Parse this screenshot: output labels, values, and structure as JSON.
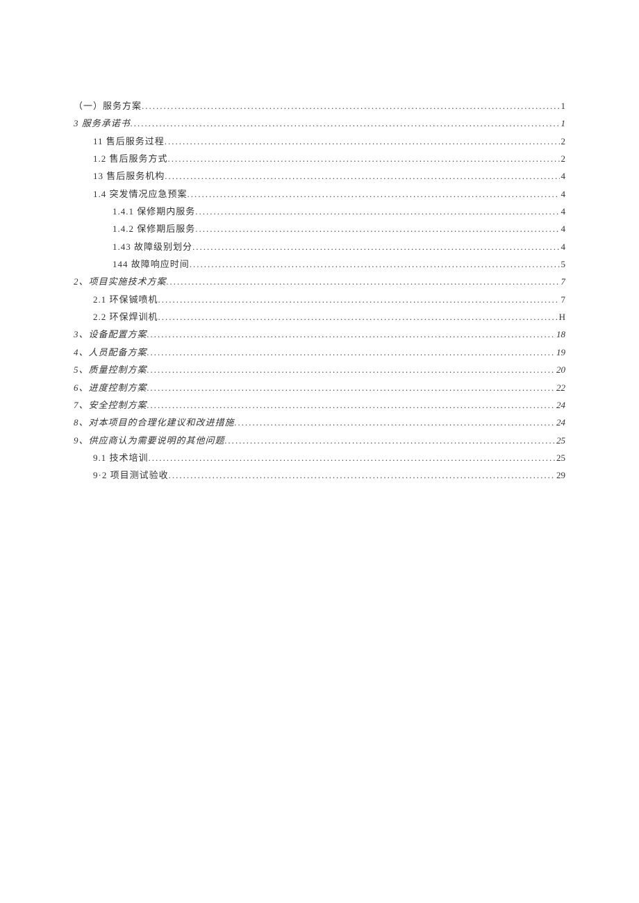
{
  "toc": [
    {
      "label": "（一）服务方案",
      "page": "1",
      "indent": 0,
      "italic": false
    },
    {
      "label": "3 服务承诺书 ",
      "page": "1",
      "indent": 0,
      "italic": true
    },
    {
      "label": "11 售后服务过程 ",
      "page": "2",
      "indent": 1,
      "italic": false
    },
    {
      "label": "1.2 售后服务方式",
      "page": "2",
      "indent": 1,
      "italic": false
    },
    {
      "label": "13 售后服务机构 ",
      "page": "4",
      "indent": 1,
      "italic": false
    },
    {
      "label": "1.4 突发情况应急预案",
      "page": "4",
      "indent": 1,
      "italic": false
    },
    {
      "label": "1.4.1 保修期内服务 ",
      "page": "4",
      "indent": 2,
      "italic": false
    },
    {
      "label": "1.4.2 保修期后服务 ",
      "page": "4",
      "indent": 2,
      "italic": false
    },
    {
      "label": "1.43 故障级别划分 ",
      "page": "4",
      "indent": 2,
      "italic": false
    },
    {
      "label": "144 故障响应时间 ",
      "page": "5",
      "indent": 2,
      "italic": false
    },
    {
      "label": "2、项目实施技术方案 ",
      "page": "7",
      "indent": 0,
      "italic": true
    },
    {
      "label": "2.1  环保铖喷机",
      "page": "7",
      "indent": 1,
      "italic": false
    },
    {
      "label": "2.2  环保焊训机",
      "page": "H",
      "indent": 1,
      "italic": false
    },
    {
      "label": "3、设备配置方案 ",
      "page": "18",
      "indent": 0,
      "italic": true
    },
    {
      "label": "4、人员配备方案",
      "page": "19",
      "indent": 0,
      "italic": true
    },
    {
      "label": "5、质量控制方案 ",
      "page": "20",
      "indent": 0,
      "italic": true
    },
    {
      "label": "6、进度控制方案 ",
      "page": "22",
      "indent": 0,
      "italic": true
    },
    {
      "label": "7、安全控制方案",
      "page": "24",
      "indent": 0,
      "italic": true
    },
    {
      "label": "8、对本项目的合理化建议和改进措施 ",
      "page": "24",
      "indent": 0,
      "italic": true
    },
    {
      "label": "9、供应商认为需要说明的其他问题 ",
      "page": "25",
      "indent": 0,
      "italic": true
    },
    {
      "label": "9.1  技术培训 ",
      "page": "25",
      "indent": 1,
      "italic": false
    },
    {
      "label": "9·2 项目测试验收",
      "page": "29",
      "indent": 1,
      "italic": false
    }
  ]
}
